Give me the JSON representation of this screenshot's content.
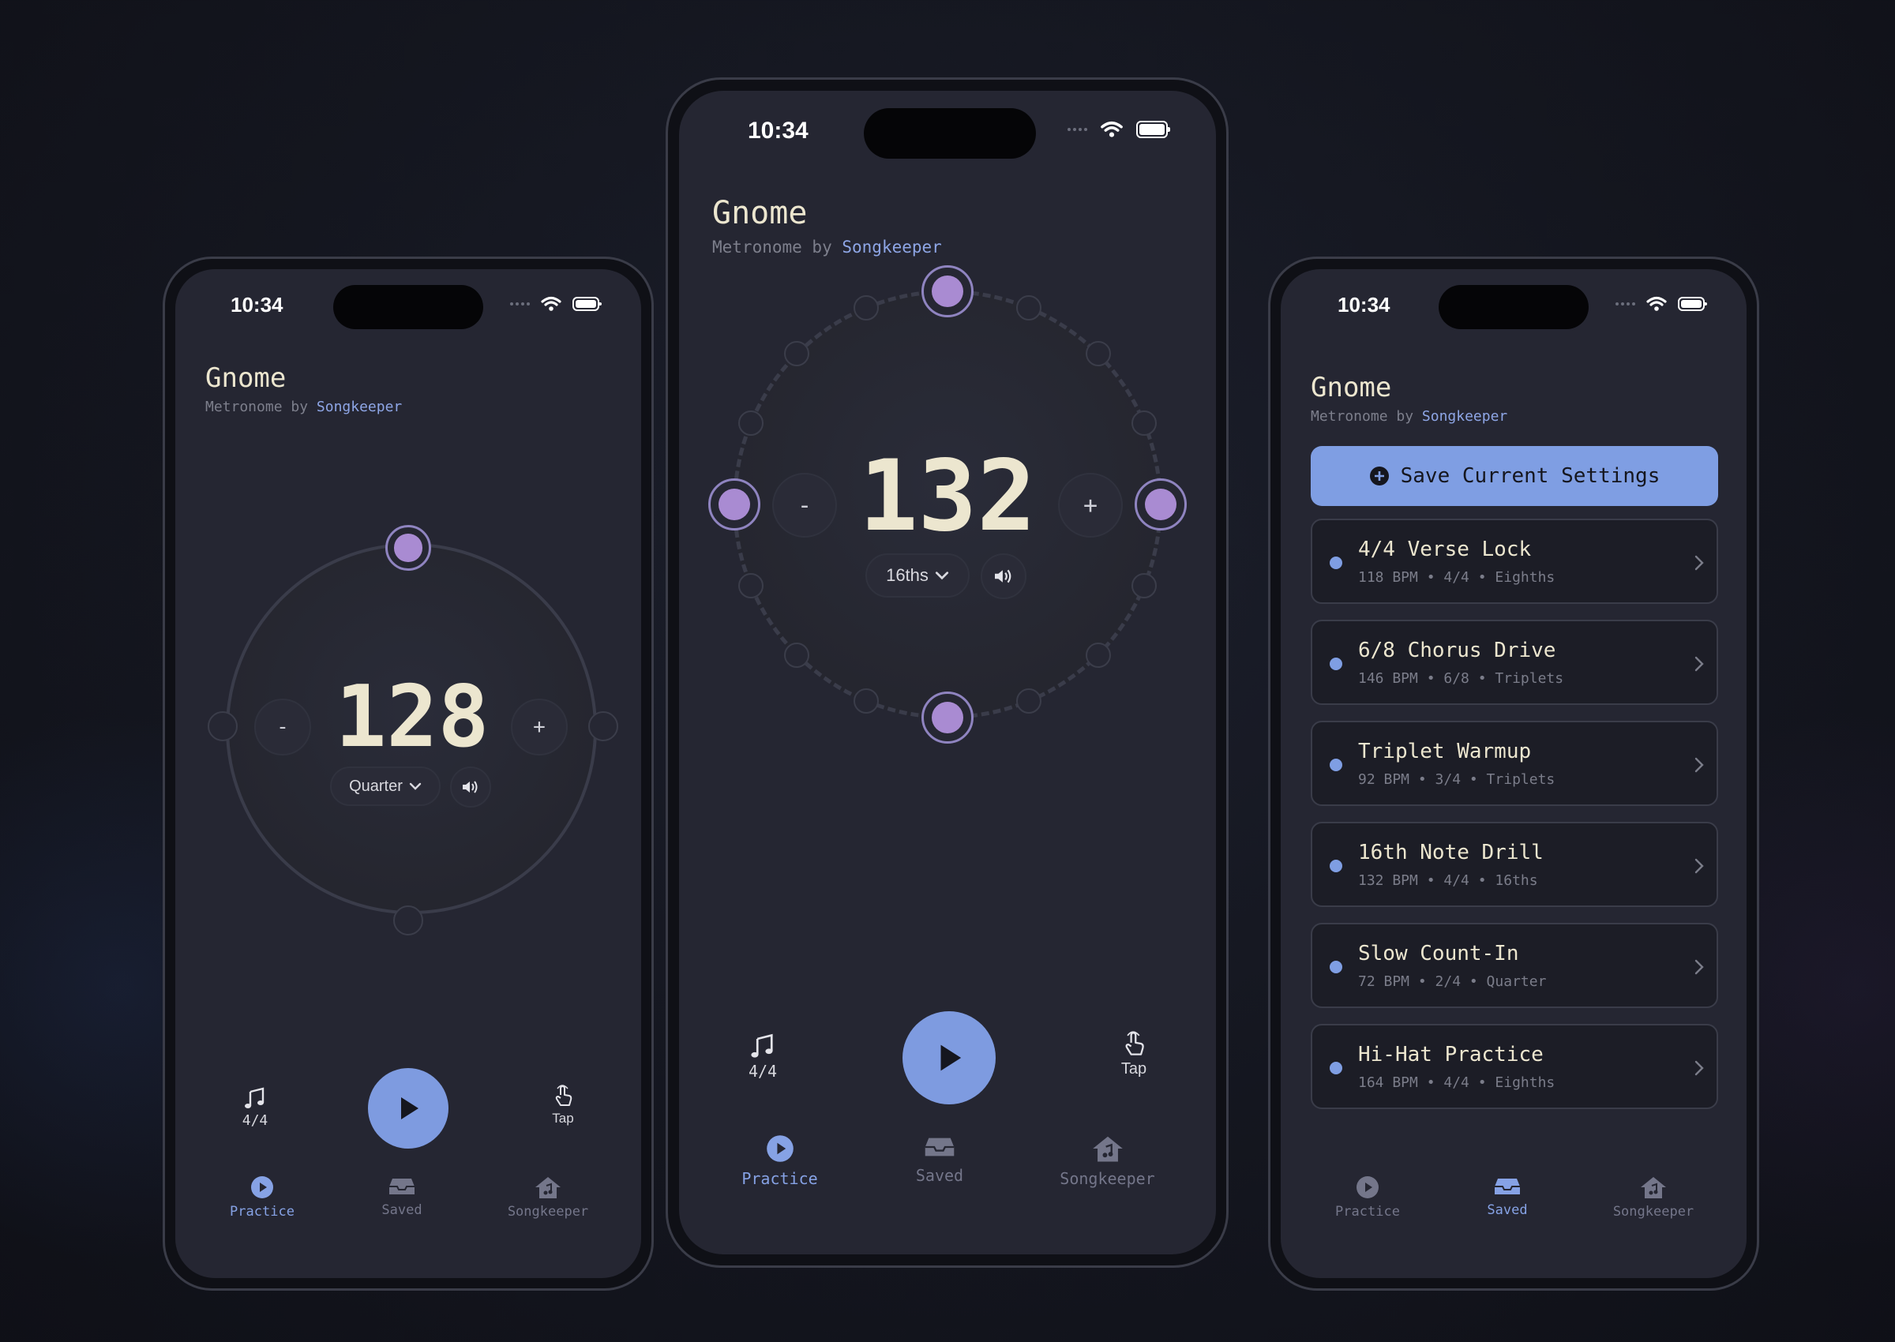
{
  "colors": {
    "accent": "#7f9ee3",
    "beat": "#a98bd2",
    "title": "#ece6cf",
    "bg": "#252632"
  },
  "status": {
    "time": "10:34"
  },
  "app": {
    "title": "Gnome",
    "subtitle_prefix": "Metronome by ",
    "subtitle_link": "Songkeeper"
  },
  "phone_left": {
    "bpm": "128",
    "minus": "-",
    "plus": "+",
    "subdivision": "Quarter",
    "time_signature": "4/4",
    "tap": "Tap"
  },
  "phone_center": {
    "bpm": "132",
    "minus": "-",
    "plus": "+",
    "subdivision": "16ths",
    "time_signature": "4/4",
    "tap": "Tap"
  },
  "tabs": {
    "practice": "Practice",
    "saved": "Saved",
    "songkeeper": "Songkeeper"
  },
  "saved": {
    "save_label": "Save Current Settings",
    "presets": [
      {
        "name": "4/4 Verse Lock",
        "meta": "118 BPM • 4/4 • Eighths"
      },
      {
        "name": "6/8 Chorus Drive",
        "meta": "146 BPM • 6/8 • Triplets"
      },
      {
        "name": "Triplet Warmup",
        "meta": "92 BPM • 3/4 • Triplets"
      },
      {
        "name": "16th Note Drill",
        "meta": "132 BPM • 4/4 • 16ths"
      },
      {
        "name": "Slow Count-In",
        "meta": "72 BPM • 2/4 • Quarter"
      },
      {
        "name": "Hi-Hat Practice",
        "meta": "164 BPM • 4/4 • Eighths"
      }
    ]
  },
  "icons": {
    "play": "play-icon",
    "sound": "speaker-icon",
    "notes": "music-notes-icon",
    "tap": "tap-hand-icon",
    "saved": "inbox-tray-icon",
    "home": "music-house-icon",
    "plus": "plus-circle-icon",
    "chevron": "chevron-right-icon",
    "dropdown": "chevron-down-icon"
  }
}
